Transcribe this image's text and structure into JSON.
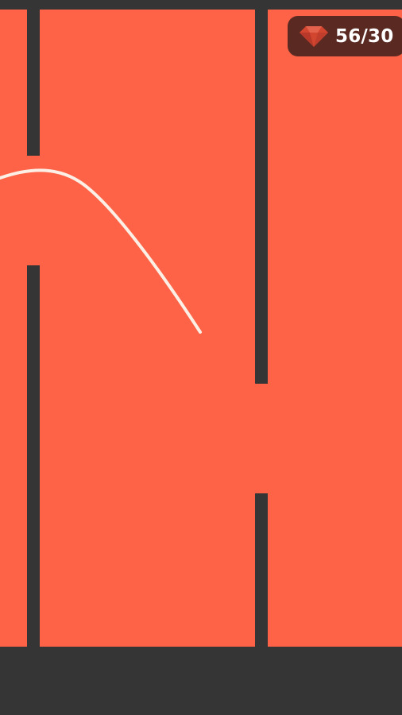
{
  "hud": {
    "gems_label": "56/30",
    "gem_icon": "ruby-gem-icon"
  },
  "colors": {
    "background": "#353535",
    "playfield": "#ff6347",
    "wall": "#353535",
    "trail": "#fbefe6",
    "counter_bg": "#5a2a22",
    "gem": "#d2452f"
  }
}
